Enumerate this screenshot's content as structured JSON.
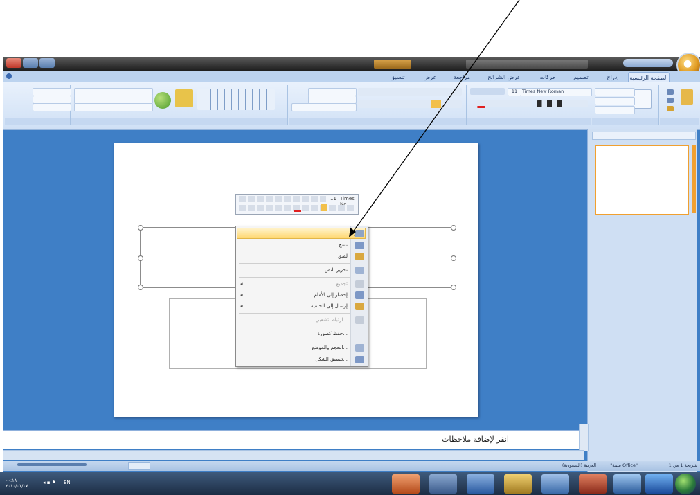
{
  "ribbon": {
    "tabs": [
      "الصفحة الرئيسية",
      "إدراج",
      "تصميم",
      "حركات",
      "عرض الشرائح",
      "مراجعة",
      "عرض",
      "تنسيق"
    ],
    "font_name": "Times New Roman",
    "font_size": "11"
  },
  "slide_thumbnail_index": "1",
  "context_menu": {
    "items": [
      {
        "label": "قص",
        "state": "highlighted"
      },
      {
        "label": "نسخ",
        "state": "normal"
      },
      {
        "label": "لصق",
        "state": "normal"
      },
      {
        "label": "تحرير النص",
        "state": "normal"
      },
      {
        "label": "تجميع",
        "state": "disabled",
        "submenu": true
      },
      {
        "label": "إحضار إلى الأمام",
        "state": "normal",
        "submenu": true
      },
      {
        "label": "إرسال إلى الخلفية",
        "state": "normal",
        "submenu": true
      },
      {
        "label": "ارتباط تشعبي...",
        "state": "disabled"
      },
      {
        "label": "حفظ كصورة...",
        "state": "normal"
      },
      {
        "label": "الحجم والموضع...",
        "state": "normal"
      },
      {
        "label": "تنسيق الشكل...",
        "state": "normal"
      }
    ]
  },
  "mini_toolbar": {
    "font": "Times Ne",
    "size": "11"
  },
  "notes": {
    "placeholder": "انقر لإضافة ملاحظات"
  },
  "statusbar": {
    "slide": "شريحة 1 من 1",
    "theme": "\"سمة Office\"",
    "language": "العربية (السعودية)"
  },
  "taskbar": {
    "time": "٠٠:١٨",
    "date": "٢٠١٠/٠١/٠٧",
    "lang": "EN"
  },
  "colors": {
    "window_blue": "#3f7fc6",
    "ribbon": "#dbe8f7",
    "highlight": "#ffd873",
    "thumb_border": "#f0a030"
  }
}
